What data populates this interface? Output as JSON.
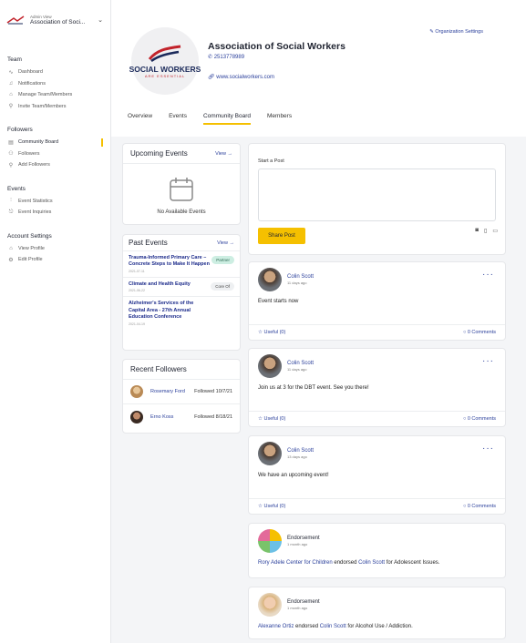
{
  "sidebar": {
    "role": "Admin View",
    "org_short": "Association of Soci...",
    "sections": {
      "team": "Team",
      "followers": "Followers",
      "events": "Events",
      "account": "Account Settings"
    },
    "team_items": [
      "Dashboard",
      "Notifications",
      "Manage Team/Members",
      "Invite Team/Members"
    ],
    "followers_items": [
      "Community Board",
      "Followers",
      "Add Followers"
    ],
    "events_items": [
      "Event Statistics",
      "Event Inquiries"
    ],
    "account_items": [
      "View Profile",
      "Edit Profile"
    ]
  },
  "header": {
    "org_name": "Association of Social Workers",
    "phone": "2513778989",
    "website": "www.socialworkers.com",
    "settings_label": "Organization Settings",
    "logo_text": "SOCIAL WORKERS",
    "logo_sub": "ARE ESSENTIAL"
  },
  "tabs": [
    "Overview",
    "Events",
    "Community Board",
    "Members"
  ],
  "upcoming": {
    "title": "Upcoming Events",
    "view_label": "View →",
    "empty_text": "No Available Events"
  },
  "past": {
    "title": "Past Events",
    "view_label": "View →",
    "events": [
      {
        "title": "Trauma-Informed Primary Care – Concrete Steps to Make It Happen",
        "date": "2021-07-11",
        "tag": "Partner"
      },
      {
        "title": "Climate and Health Equity",
        "date": "2021-06-22",
        "tag": "Core Of"
      },
      {
        "title": "Alzheimer's Services of the Capital Area - 27th Annual Education Conference",
        "date": "2021-04-19",
        "tag": ""
      }
    ]
  },
  "recent_followers": {
    "title": "Recent Followers",
    "items": [
      {
        "name": "Rosemary Ford",
        "followed": "Followed 10/7/21"
      },
      {
        "name": "Erno Koss",
        "followed": "Followed 8/18/21"
      }
    ]
  },
  "composer": {
    "label": "Start a Post",
    "share_label": "Share Post"
  },
  "posts": [
    {
      "author": "Colin Scott",
      "time": "11 days ago",
      "body": "Event starts now",
      "useful": "Useful (0)",
      "comments": "0 Comments"
    },
    {
      "author": "Colin Scott",
      "time": "11 days ago",
      "body": "Join us at 3 for the DBT event. See you there!",
      "useful": "Useful (0)",
      "comments": "0 Comments"
    },
    {
      "author": "Colin Scott",
      "time": "13 days ago",
      "body": "We have an upcoming event!",
      "useful": "Useful (0)",
      "comments": "0 Comments"
    }
  ],
  "endorsements": [
    {
      "label": "Endorsement",
      "time": "1 month ago",
      "endorser": "Rory Adele Center for Children",
      "mid": " endorsed ",
      "endorsee": "Colin Scott",
      "tail": " for Adolescent Issues."
    },
    {
      "label": "Endorsement",
      "time": "1 month ago",
      "endorser": "Alexanne Ortiz",
      "mid": " endorsed ",
      "endorsee": "Colin Scott",
      "tail": " for Alcohol Use / Addiction."
    }
  ],
  "colors": {
    "accent": "#f5c000",
    "link": "#2a3f9b",
    "partner_bg": "#cdeee2"
  }
}
